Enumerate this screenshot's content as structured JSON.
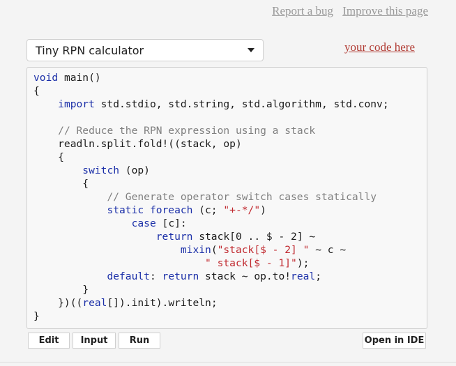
{
  "header": {
    "links": [
      {
        "label": "Report a bug",
        "name": "report-bug-link"
      },
      {
        "label": "Improve this page",
        "name": "improve-page-link"
      }
    ]
  },
  "example_select": {
    "selected": "Tiny RPN calculator"
  },
  "your_code_link": "your code here",
  "colors": {
    "keyword": "#1b2fa8",
    "comment": "#808080",
    "string": "#c0282e",
    "text": "#1a1a1a",
    "link_accent": "#b03931"
  },
  "editor": {
    "lines": [
      [
        [
          "kw",
          "void"
        ],
        [
          "tx",
          " main()"
        ]
      ],
      [
        [
          "tx",
          "{"
        ]
      ],
      [
        [
          "tx",
          "    "
        ],
        [
          "kw",
          "import"
        ],
        [
          "tx",
          " std.stdio, std.string, std.algorithm, std.conv;"
        ]
      ],
      [],
      [
        [
          "tx",
          "    "
        ],
        [
          "cm",
          "// Reduce the RPN expression using a stack"
        ]
      ],
      [
        [
          "tx",
          "    readln.split.fold!((stack, op)"
        ]
      ],
      [
        [
          "tx",
          "    {"
        ]
      ],
      [
        [
          "tx",
          "        "
        ],
        [
          "kw",
          "switch"
        ],
        [
          "tx",
          " (op)"
        ]
      ],
      [
        [
          "tx",
          "        {"
        ]
      ],
      [
        [
          "tx",
          "            "
        ],
        [
          "cm",
          "// Generate operator switch cases statically"
        ]
      ],
      [
        [
          "tx",
          "            "
        ],
        [
          "kw",
          "static foreach"
        ],
        [
          "tx",
          " (c; "
        ],
        [
          "str",
          "\"+-*/\""
        ],
        [
          "tx",
          ")"
        ]
      ],
      [
        [
          "tx",
          "                "
        ],
        [
          "kw",
          "case"
        ],
        [
          "tx",
          " [c]:"
        ]
      ],
      [
        [
          "tx",
          "                    "
        ],
        [
          "kw",
          "return"
        ],
        [
          "tx",
          " stack[0 .. $ - 2] ~"
        ]
      ],
      [
        [
          "tx",
          "                        "
        ],
        [
          "kw",
          "mixin"
        ],
        [
          "tx",
          "("
        ],
        [
          "str",
          "\"stack[$ - 2] \""
        ],
        [
          "tx",
          " ~ c ~"
        ]
      ],
      [
        [
          "tx",
          "                            "
        ],
        [
          "str",
          "\" stack[$ - 1]\""
        ],
        [
          "tx",
          ");"
        ]
      ],
      [
        [
          "tx",
          "            "
        ],
        [
          "kw",
          "default"
        ],
        [
          "tx",
          ": "
        ],
        [
          "kw",
          "return"
        ],
        [
          "tx",
          " stack ~ op.to!"
        ],
        [
          "kw",
          "real"
        ],
        [
          "tx",
          ";"
        ]
      ],
      [
        [
          "tx",
          "        }"
        ]
      ],
      [
        [
          "tx",
          "    })(("
        ],
        [
          "kw",
          "real"
        ],
        [
          "tx",
          "[]).init).writeln;"
        ]
      ],
      [
        [
          "tx",
          "}"
        ]
      ]
    ]
  },
  "buttons": {
    "edit": "Edit",
    "input": "Input",
    "run": "Run",
    "open_ide": "Open in IDE"
  }
}
